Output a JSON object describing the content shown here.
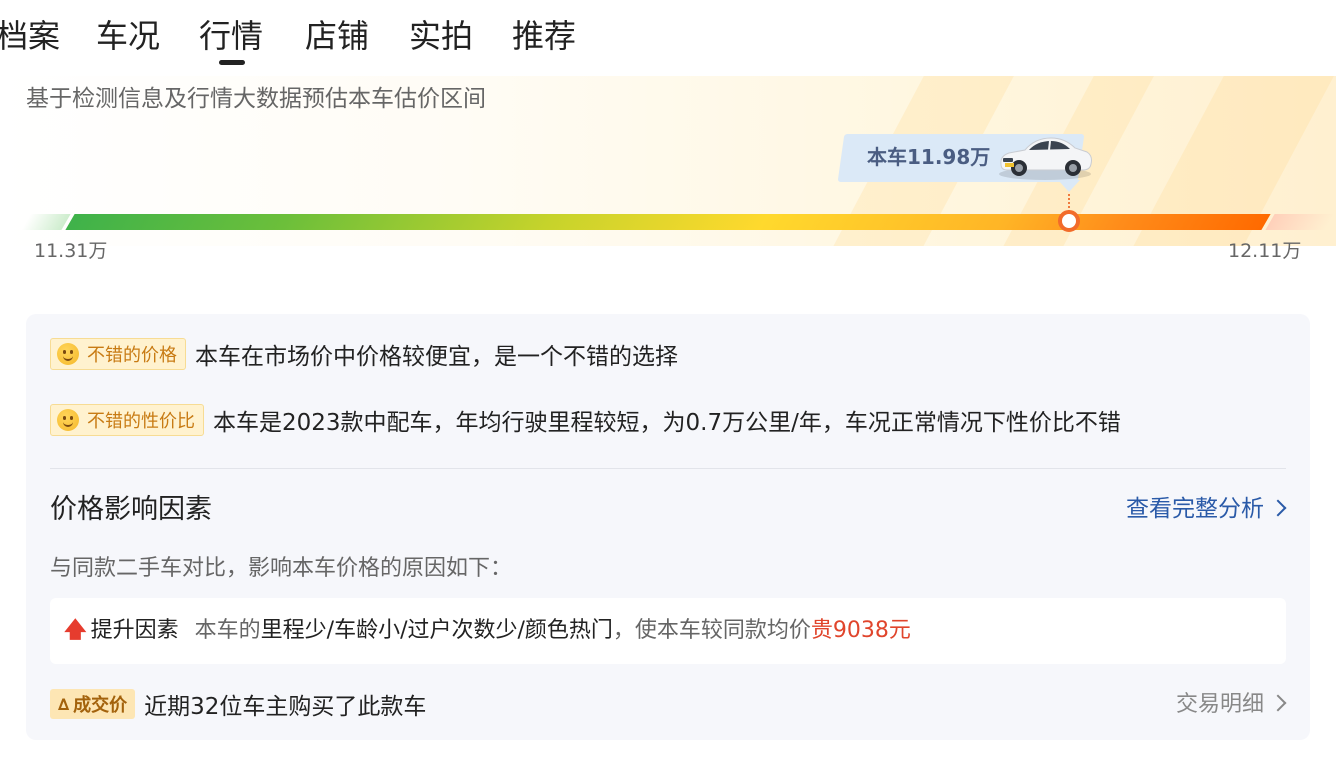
{
  "tabs": [
    {
      "label": "档案"
    },
    {
      "label": "车况"
    },
    {
      "label": "行情",
      "active": true
    },
    {
      "label": "店铺"
    },
    {
      "label": "实拍"
    },
    {
      "label": "推荐"
    }
  ],
  "price_range": {
    "subtitle": "基于检测信息及行情大数据预估本车估价区间",
    "current_label": "本车11.98万",
    "min_label": "11.31万",
    "max_label": "12.11万",
    "min": 11.31,
    "max": 12.11,
    "current": 11.98
  },
  "evaluations": [
    {
      "badge": "不错的价格",
      "text": "本车在市场价中价格较便宜，是一个不错的选择"
    },
    {
      "badge": "不错的性价比",
      "text": "本车是2023款中配车，年均行驶里程较短，为0.7万公里/年，车况正常情况下性价比不错"
    }
  ],
  "factors": {
    "title": "价格影响因素",
    "link_label": "查看完整分析",
    "compare_text": "与同款二手车对比，影响本车价格的原因如下：",
    "rise": {
      "label": "提升因素",
      "pre": "本车的",
      "items": "里程少/车龄小/过户次数少/颜色热门",
      "post": "，使本车较同款均价",
      "price": "贵9038元"
    }
  },
  "deals": {
    "badge": "成交价",
    "text": "近期32位车主购买了此款车",
    "link_label": "交易明细"
  },
  "colors": {
    "accent_blue": "#2a5aa8",
    "price_red": "#e0452c",
    "badge_orange": "#c87b14"
  }
}
